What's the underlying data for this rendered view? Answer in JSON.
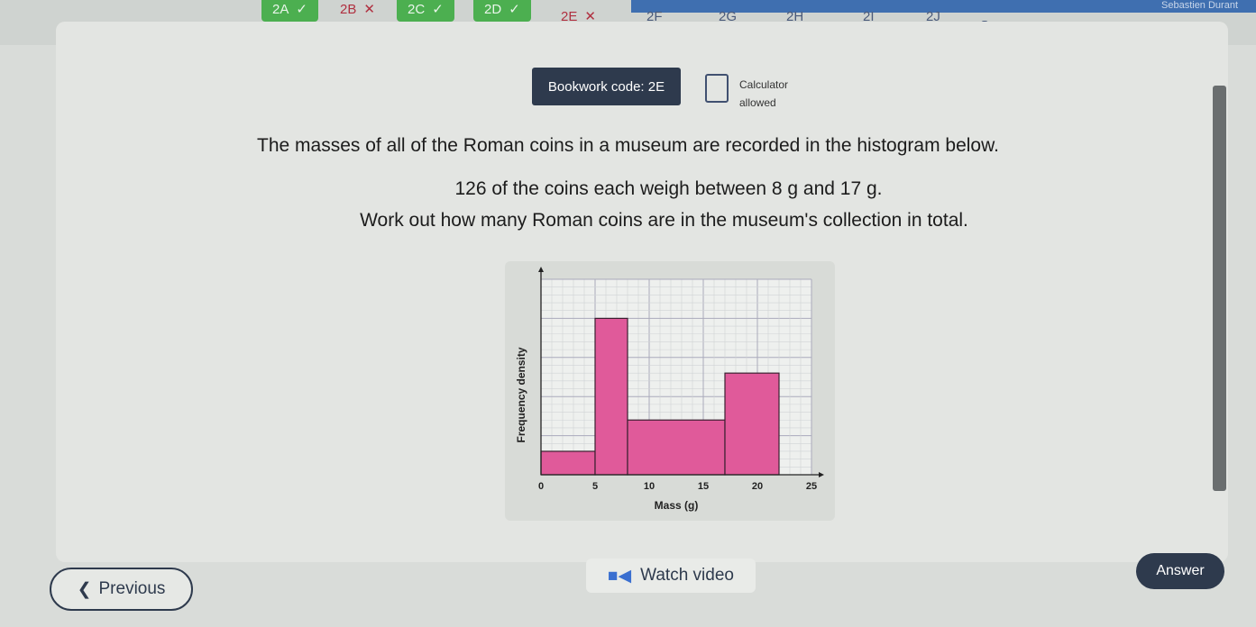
{
  "user": "Sebastien Durant",
  "tabs": [
    {
      "label": "2A",
      "status": "correct"
    },
    {
      "label": "2B",
      "status": "incorrect"
    },
    {
      "label": "2C",
      "status": "correct"
    },
    {
      "label": "2D",
      "status": "correct"
    },
    {
      "label": "2E",
      "status": "incorrect"
    },
    {
      "label": "2F",
      "status": ""
    },
    {
      "label": "2G",
      "status": ""
    },
    {
      "label": "2H",
      "status": ""
    },
    {
      "label": "2I",
      "status": ""
    },
    {
      "label": "2J",
      "status": ""
    },
    {
      "label": "Summary",
      "status": ""
    }
  ],
  "bookwork": "Bookwork code: 2E",
  "calculator": {
    "line1": "Calculator",
    "line2": "allowed",
    "icon": "calculator-check-icon"
  },
  "question": {
    "line1": "The masses of all of the Roman coins in a museum are recorded in the histogram below.",
    "line2": "126 of the coins each weigh between 8 g and 17 g.",
    "line3": "Work out how many Roman coins are in the museum's collection in total."
  },
  "chart_data": {
    "type": "histogram",
    "xlabel": "Mass (g)",
    "ylabel": "Frequency density",
    "xticks": [
      "0",
      "5",
      "10",
      "15",
      "20",
      "25"
    ],
    "xlim": [
      0,
      25
    ],
    "ylim": [
      0,
      25
    ],
    "grid": true,
    "bar_color": "#e05a9a",
    "bars": [
      {
        "from": 0,
        "to": 5,
        "density": 3
      },
      {
        "from": 5,
        "to": 8,
        "density": 20
      },
      {
        "from": 8,
        "to": 17,
        "density": 7
      },
      {
        "from": 17,
        "to": 22,
        "density": 13
      }
    ]
  },
  "buttons": {
    "previous": "Previous",
    "watch_video": "Watch video",
    "answer": "Answer"
  }
}
